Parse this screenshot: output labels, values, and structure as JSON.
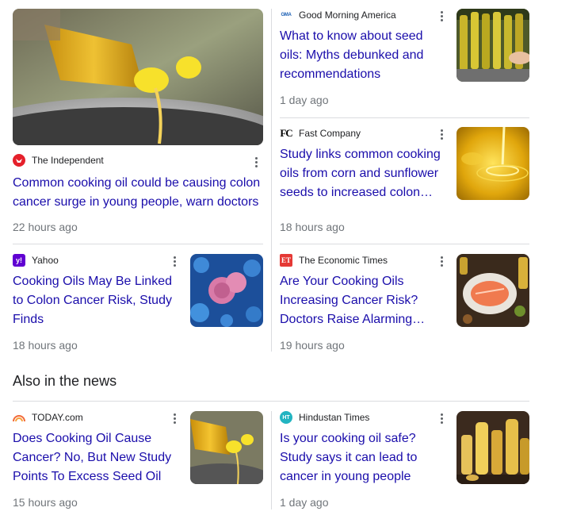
{
  "cards": {
    "independent": {
      "source": "The Independent",
      "headline": "Common cooking oil could be causing colon cancer surge in young people, warn doctors",
      "time": "22 hours ago",
      "icon": "independent-eagle-icon",
      "color": "#e5202b"
    },
    "gma": {
      "source": "Good Morning America",
      "headline": "What to know about seed oils: Myths debunked and recommendations",
      "time": "1 day ago",
      "icon": "gma-logo-icon",
      "favicon_text": "GMA",
      "color": "#1a5fb4"
    },
    "fastcompany": {
      "source": "Fast Company",
      "headline": "Study links common cooking oils from corn and sunflower seeds to increased colon…",
      "time": "18 hours ago",
      "icon": "fc-logo-icon",
      "favicon_text": "FC",
      "color": "#000000"
    },
    "yahoo": {
      "source": "Yahoo",
      "headline": "Cooking Oils May Be Linked to Colon Cancer Risk, Study Finds",
      "time": "18 hours ago",
      "icon": "yahoo-logo-icon",
      "favicon_text": "y!",
      "color": "#6001d2"
    },
    "economictimes": {
      "source": "The Economic Times",
      "headline": "Are Your Cooking Oils Increasing Cancer Risk? Doctors Raise Alarming…",
      "time": "19 hours ago",
      "icon": "et-logo-icon",
      "favicon_text": "ET",
      "color": "#e53935"
    },
    "today": {
      "source": "TODAY.com",
      "headline": "Does Cooking Oil Cause Cancer? No, But New Study Points To Excess Seed Oil",
      "time": "15 hours ago",
      "icon": "today-rainbow-icon",
      "color": "#f26b3a"
    },
    "hindustan": {
      "source": "Hindustan Times",
      "headline": "Is your cooking oil safe? Study says it can lead to cancer in young people",
      "time": "1 day ago",
      "icon": "ht-logo-icon",
      "favicon_text": "HT",
      "color": "#22b4c1"
    }
  },
  "section": {
    "also_in_news": "Also in the news"
  },
  "colors": {
    "link": "#1a0dab",
    "meta": "#70757a",
    "divider": "#dadce0"
  }
}
